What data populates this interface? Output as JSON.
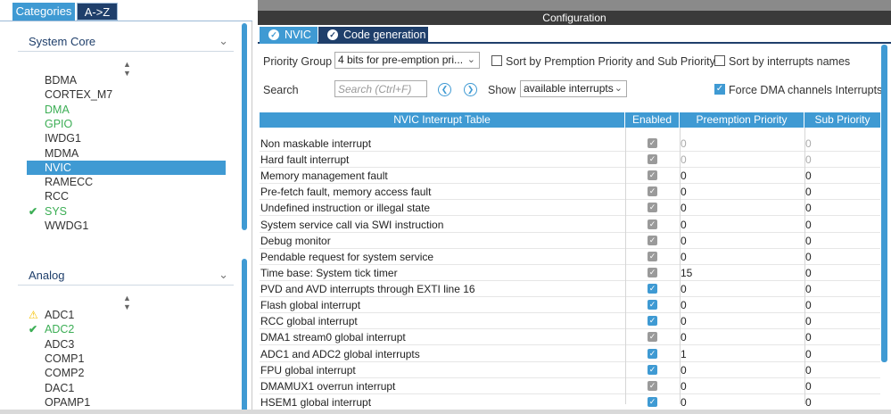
{
  "left": {
    "tabs": [
      "Categories",
      "A->Z"
    ],
    "sections": [
      {
        "title": "System Core",
        "items": [
          {
            "label": "BDMA",
            "status": ""
          },
          {
            "label": "CORTEX_M7",
            "status": ""
          },
          {
            "label": "DMA",
            "status": "green"
          },
          {
            "label": "GPIO",
            "status": "green"
          },
          {
            "label": "IWDG1",
            "status": ""
          },
          {
            "label": "MDMA",
            "status": ""
          },
          {
            "label": "NVIC",
            "status": "selected"
          },
          {
            "label": "RAMECC",
            "status": ""
          },
          {
            "label": "RCC",
            "status": ""
          },
          {
            "label": "SYS",
            "status": "check"
          },
          {
            "label": "WWDG1",
            "status": ""
          }
        ]
      },
      {
        "title": "Analog",
        "items": [
          {
            "label": "ADC1",
            "status": "warning"
          },
          {
            "label": "ADC2",
            "status": "check"
          },
          {
            "label": "ADC3",
            "status": ""
          },
          {
            "label": "COMP1",
            "status": ""
          },
          {
            "label": "COMP2",
            "status": ""
          },
          {
            "label": "DAC1",
            "status": ""
          },
          {
            "label": "OPAMP1",
            "status": ""
          }
        ]
      }
    ]
  },
  "header": {
    "title": "Configuration",
    "tabs": [
      "NVIC",
      "Code generation"
    ]
  },
  "controls": {
    "priority_group_label": "Priority Group",
    "priority_group_value": "4 bits for pre-emption pri...",
    "sort_premption_label": "Sort by Premption Priority and Sub Priority",
    "sort_premption_checked": false,
    "sort_names_label": "Sort by interrupts names",
    "sort_names_checked": false,
    "search_label": "Search",
    "search_placeholder": "Search (Ctrl+F)",
    "show_label": "Show",
    "show_value": "available interrupts",
    "force_dma_label": "Force DMA channels Interrupts",
    "force_dma_checked": true
  },
  "table": {
    "columns": [
      "NVIC Interrupt Table",
      "Enabled",
      "Preemption Priority",
      "Sub Priority"
    ],
    "rows": [
      {
        "name": "Non maskable interrupt",
        "enabled": "locked",
        "pre": "0",
        "sub": "0",
        "dim": true
      },
      {
        "name": "Hard fault interrupt",
        "enabled": "locked",
        "pre": "0",
        "sub": "0",
        "dim": true
      },
      {
        "name": "Memory management fault",
        "enabled": "locked",
        "pre": "0",
        "sub": "0",
        "dim": false
      },
      {
        "name": "Pre-fetch fault, memory access fault",
        "enabled": "locked",
        "pre": "0",
        "sub": "0",
        "dim": false
      },
      {
        "name": "Undefined instruction or illegal state",
        "enabled": "locked",
        "pre": "0",
        "sub": "0",
        "dim": false
      },
      {
        "name": "System service call via SWI instruction",
        "enabled": "locked",
        "pre": "0",
        "sub": "0",
        "dim": false
      },
      {
        "name": "Debug monitor",
        "enabled": "locked",
        "pre": "0",
        "sub": "0",
        "dim": false
      },
      {
        "name": "Pendable request for system service",
        "enabled": "locked",
        "pre": "0",
        "sub": "0",
        "dim": false
      },
      {
        "name": "Time base: System tick timer",
        "enabled": "locked",
        "pre": "15",
        "sub": "0",
        "dim": false
      },
      {
        "name": "PVD and AVD interrupts through EXTI line 16",
        "enabled": "on",
        "pre": "0",
        "sub": "0",
        "dim": false
      },
      {
        "name": "Flash global interrupt",
        "enabled": "on",
        "pre": "0",
        "sub": "0",
        "dim": false
      },
      {
        "name": "RCC global interrupt",
        "enabled": "on",
        "pre": "0",
        "sub": "0",
        "dim": false
      },
      {
        "name": "DMA1 stream0 global interrupt",
        "enabled": "locked",
        "pre": "0",
        "sub": "0",
        "dim": false
      },
      {
        "name": "ADC1 and ADC2 global interrupts",
        "enabled": "on",
        "pre": "1",
        "sub": "0",
        "dim": false
      },
      {
        "name": "FPU global interrupt",
        "enabled": "on",
        "pre": "0",
        "sub": "0",
        "dim": false
      },
      {
        "name": "DMAMUX1 overrun interrupt",
        "enabled": "locked",
        "pre": "0",
        "sub": "0",
        "dim": false
      },
      {
        "name": "HSEM1 global interrupt",
        "enabled": "on",
        "pre": "0",
        "sub": "0",
        "dim": false
      }
    ]
  },
  "colors": {
    "accent": "#3f9ad3",
    "navy": "#1f3f6b",
    "ok_green": "#3cae55",
    "warning_yellow": "#f5c000",
    "locked_grey": "#9a9a9a"
  }
}
